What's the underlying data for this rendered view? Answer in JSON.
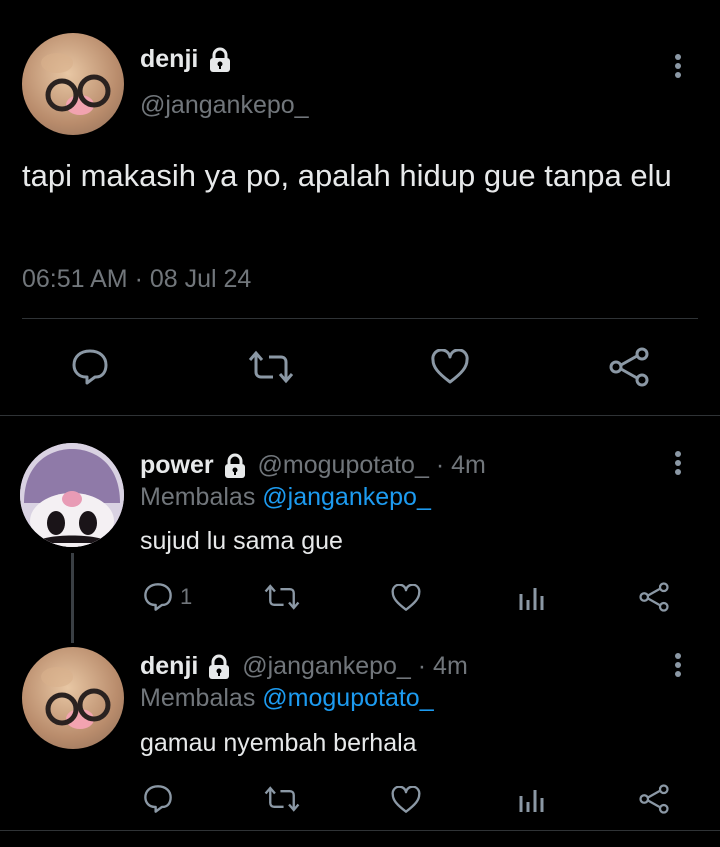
{
  "main_tweet": {
    "display_name": "denji",
    "handle": "@jangankepo_",
    "text": "tapi makasih ya po, apalah hidup gue tanpa elu",
    "timestamp": "06:51 AM · 08 Jul 24"
  },
  "replies": [
    {
      "display_name": "power",
      "handle": "@mogupotato_",
      "time": "· 4m",
      "replying_prefix": "Membalas",
      "replying_to": "@jangankepo_",
      "text": "sujud lu sama gue",
      "reply_count": "1"
    },
    {
      "display_name": "denji",
      "handle": "@jangankepo_",
      "time": "· 4m",
      "replying_prefix": "Membalas",
      "replying_to": "@mogupotato_",
      "text": "gamau nyembah berhala",
      "reply_count": ""
    }
  ],
  "colors": {
    "background": "#000000",
    "text_primary": "#e7e9ea",
    "text_muted": "#71767b",
    "link": "#1d9bf0",
    "divider": "#2f3336",
    "icon": "#8b98a5"
  }
}
